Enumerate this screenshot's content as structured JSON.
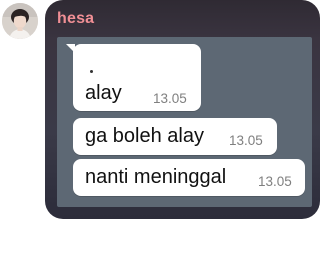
{
  "chat": {
    "sender_name": "hesa",
    "avatar_icon": "profile-photo",
    "messages": [
      {
        "text": "alay",
        "time": "13.05",
        "pre_text": "."
      },
      {
        "text": "ga boleh alay",
        "time": "13.05"
      },
      {
        "text": "nanti meninggal",
        "time": "13.05"
      }
    ]
  },
  "colors": {
    "sender_name": "#f08f95",
    "card_background": "#3a3440",
    "chat_background": "#5d6874",
    "bubble_background": "#ffffff",
    "timestamp": "#7f7f7f"
  }
}
